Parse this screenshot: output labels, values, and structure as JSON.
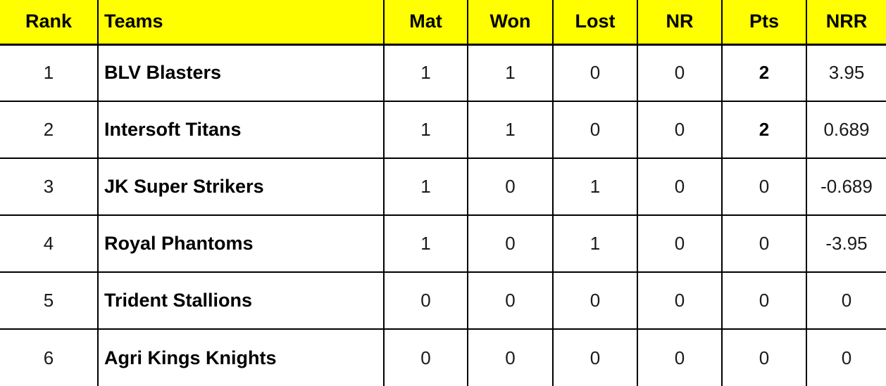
{
  "table": {
    "accent_color": "#ffff00",
    "text_color": "#000000",
    "border_color": "#000000",
    "columns": [
      {
        "key": "rank",
        "label": "Rank"
      },
      {
        "key": "team",
        "label": "Teams"
      },
      {
        "key": "mat",
        "label": "Mat"
      },
      {
        "key": "won",
        "label": "Won"
      },
      {
        "key": "lost",
        "label": "Lost"
      },
      {
        "key": "nr",
        "label": "NR"
      },
      {
        "key": "pts",
        "label": "Pts"
      },
      {
        "key": "nrr",
        "label": "NRR"
      }
    ],
    "rows": [
      {
        "rank": "1",
        "team": "BLV Blasters",
        "mat": "1",
        "won": "1",
        "lost": "0",
        "nr": "0",
        "pts": "2",
        "pts_bold": true,
        "nrr": "3.95"
      },
      {
        "rank": "2",
        "team": "Intersoft Titans",
        "mat": "1",
        "won": "1",
        "lost": "0",
        "nr": "0",
        "pts": "2",
        "pts_bold": true,
        "nrr": "0.689"
      },
      {
        "rank": "3",
        "team": "JK Super Strikers",
        "mat": "1",
        "won": "0",
        "lost": "1",
        "nr": "0",
        "pts": "0",
        "pts_bold": false,
        "nrr": "-0.689"
      },
      {
        "rank": "4",
        "team": "Royal Phantoms",
        "mat": "1",
        "won": "0",
        "lost": "1",
        "nr": "0",
        "pts": "0",
        "pts_bold": false,
        "nrr": "-3.95"
      },
      {
        "rank": "5",
        "team": "Trident Stallions",
        "mat": "0",
        "won": "0",
        "lost": "0",
        "nr": "0",
        "pts": "0",
        "pts_bold": false,
        "nrr": "0"
      },
      {
        "rank": "6",
        "team": "Agri Kings Knights",
        "mat": "0",
        "won": "0",
        "lost": "0",
        "nr": "0",
        "pts": "0",
        "pts_bold": false,
        "nrr": "0"
      }
    ]
  }
}
